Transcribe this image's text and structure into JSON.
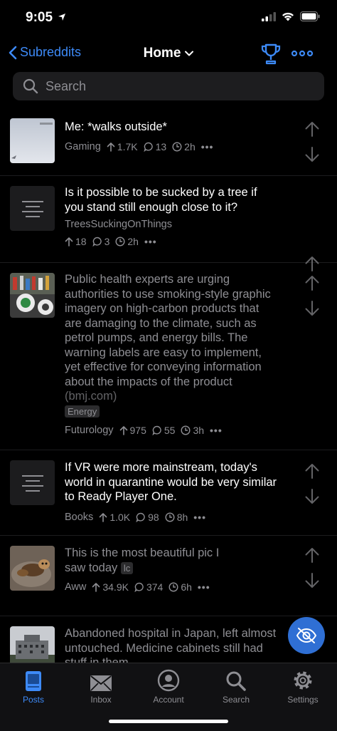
{
  "status": {
    "time": "9:05"
  },
  "nav": {
    "back_label": "Subreddits",
    "title": "Home"
  },
  "search": {
    "placeholder": "Search"
  },
  "posts": [
    {
      "title": "Me: *walks outside*",
      "subreddit": "Gaming",
      "upvotes": "1.7K",
      "comments": "13",
      "age": "2h",
      "thumbnail": "image",
      "visited": false
    },
    {
      "title": "Is it possible to be sucked by a tree if you stand still enough close to it?",
      "subreddit": "TreesSuckingOnThings",
      "upvotes": "18",
      "comments": "3",
      "age": "2h",
      "thumbnail": "text",
      "visited": false
    },
    {
      "title": "Public health experts are urging authorities to use smoking-style graphic imagery on high-carbon products that are damaging to the climate, such as petrol pumps, and energy bills. The warning labels are easy to implement, yet effective for conveying information about the impacts of the product",
      "domain": "(bmj.com)",
      "flair": "Energy",
      "subreddit": "Futurology",
      "upvotes": "975",
      "comments": "55",
      "age": "3h",
      "thumbnail": "image",
      "visited": true
    },
    {
      "title": "If VR were more mainstream, today's world in quarantine would be very similar to Ready Player One.",
      "subreddit": "Books",
      "upvotes": "1.0K",
      "comments": "98",
      "age": "8h",
      "thumbnail": "text",
      "visited": false
    },
    {
      "title": "This is the most beautiful pic I saw today",
      "flair": "lc",
      "subreddit": "Aww",
      "upvotes": "34.9K",
      "comments": "374",
      "age": "6h",
      "thumbnail": "image",
      "visited": true
    },
    {
      "title": "Abandoned hospital in Japan, left almost untouched. Medicine cabinets still had stuff in them.",
      "thumbnail": "image",
      "visited": true
    }
  ],
  "tabs": [
    {
      "label": "Posts",
      "icon": "posts-icon",
      "active": true
    },
    {
      "label": "Inbox",
      "icon": "inbox-icon",
      "active": false
    },
    {
      "label": "Account",
      "icon": "account-icon",
      "active": false
    },
    {
      "label": "Search",
      "icon": "search-icon",
      "active": false
    },
    {
      "label": "Settings",
      "icon": "settings-icon",
      "active": false
    }
  ],
  "colors": {
    "accent": "#3d8af7",
    "background": "#000000",
    "secondary_text": "#8e8e93",
    "fab": "#2f6fd4"
  }
}
